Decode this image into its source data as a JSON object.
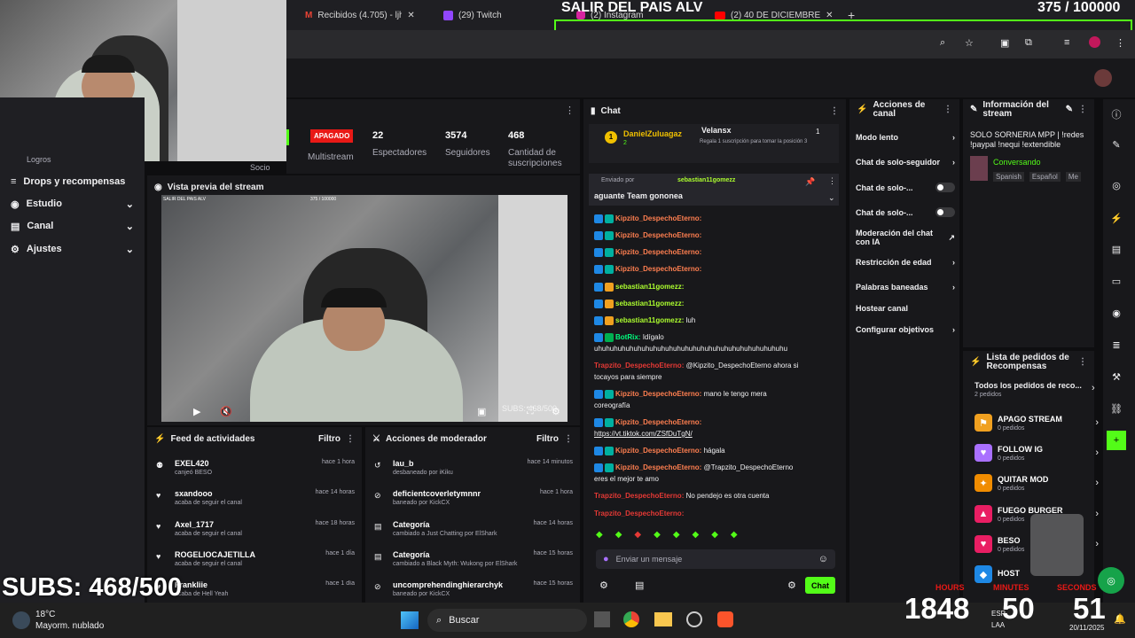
{
  "browser": {
    "tabs": [
      {
        "label": "Recibidos (4.705) - ljhe",
        "icon": "M"
      },
      {
        "label": "(29) Twitch",
        "icon": "T"
      },
      {
        "label": "(2) Instagram",
        "icon": "I"
      },
      {
        "label": "(2) 40 DE DICIEMBRE",
        "icon": "Y"
      }
    ],
    "new_tab": "+"
  },
  "overlay": {
    "title": "SALIR DEL PAIS ALV",
    "counter": "375  / 100000",
    "subs": "SUBS: 468/500",
    "timer_hours_label": "HOURS",
    "timer_minutes_label": "MINUTES",
    "timer_seconds_label": "SECONDS",
    "timer_hours": "1848",
    "timer_minutes": "50",
    "timer_seconds": "51"
  },
  "nav": {
    "partial_top": "Logros",
    "socio": "Socio",
    "items": [
      {
        "label": "Drops y recompensas",
        "icon": "≡",
        "chevron": false
      },
      {
        "label": "Estudio",
        "icon": "◉",
        "chevron": true
      },
      {
        "label": "Canal",
        "icon": "▤",
        "chevron": true
      },
      {
        "label": "Ajustes",
        "icon": "⚙",
        "chevron": true
      }
    ]
  },
  "stats": {
    "status": "APAGADO",
    "multistream": "Multistream",
    "viewers_value": "22",
    "viewers_label": "Espectadores",
    "followers_value": "3574",
    "followers_label": "Seguidores",
    "subs_value": "468",
    "subs_label": "Cantidad de suscripciones"
  },
  "preview": {
    "title": "Vista previa del stream",
    "mini_title": "SALIR DEL PAIS ALV",
    "mini_counter": "375 / 100000",
    "mini_subs": "SUBS: 468/500"
  },
  "activity_feed": {
    "title": "Feed de actividades",
    "filter": "Filtro",
    "items": [
      {
        "name": "EXEL420",
        "sub": "canjeó BESO",
        "time": "hace 1 hora",
        "icon": "gift"
      },
      {
        "name": "sxandooo",
        "sub": "acaba de seguir el canal",
        "time": "hace 14 horas",
        "icon": "heart"
      },
      {
        "name": "Axel_1717",
        "sub": "acaba de seguir el canal",
        "time": "hace 18 horas",
        "icon": "heart"
      },
      {
        "name": "ROGELIOCAJETILLA",
        "sub": "acaba de seguir el canal",
        "time": "hace 1 día",
        "icon": "heart"
      },
      {
        "name": "Frankliie",
        "sub": "acaba de Hell Yeah",
        "time": "hace 1 día",
        "icon": "heart"
      }
    ]
  },
  "mod_actions": {
    "title": "Acciones de moderador",
    "filter": "Filtro",
    "items": [
      {
        "name": "lau_b",
        "sub": "desbaneado por iKiku",
        "time": "hace 14 minutos",
        "icon": "undo"
      },
      {
        "name": "deficientcoverletymnnr",
        "sub": "baneado por KickCX",
        "time": "hace 1 hora",
        "icon": "ban"
      },
      {
        "name": "Categoría",
        "sub": "cambiado a Just Chatting por ElShark",
        "time": "hace 14 horas",
        "icon": "cat"
      },
      {
        "name": "Categoría",
        "sub": "cambiado a Black Myth: Wukong por ElShark",
        "time": "hace 15 horas",
        "icon": "cat"
      },
      {
        "name": "uncomprehendinghierarchyk",
        "sub": "baneado por KickCX",
        "time": "hace 15 horas",
        "icon": "ban"
      }
    ]
  },
  "chat": {
    "title": "Chat",
    "pinned_user": "DanielZuluagaz",
    "pinned_count": "2",
    "pinned_user2": "Velansx",
    "pinned_text2": "Regala 1 suscripción para tomar la posición 3",
    "pinned_rank": "1",
    "pinned_by": "Enviado por",
    "pinned_author": "sebastian11gomezz",
    "pinned_msg": "aguante Team gononea",
    "messages": [
      {
        "user": "Kipzito_DespechoEterno:",
        "text": "",
        "color": "#ff7f50"
      },
      {
        "user": "Kipzito_DespechoEterno:",
        "text": "",
        "color": "#ff7f50"
      },
      {
        "user": "Kipzito_DespechoEterno:",
        "text": "",
        "color": "#ff7f50"
      },
      {
        "user": "Kipzito_DespechoEterno:",
        "text": "",
        "color": "#ff7f50"
      },
      {
        "user": "sebastian11gomezz:",
        "text": "",
        "color": "#adff2f"
      },
      {
        "user": "sebastian11gomezz:",
        "text": "",
        "color": "#adff2f"
      },
      {
        "user": "sebastian11gomezz:",
        "text": "luh",
        "color": "#adff2f"
      },
      {
        "user": "BotRix:",
        "text": "Idígalo",
        "color": "#00ff7f"
      }
    ],
    "long_msg": "uhuhuhuhuhuhuhuhuhuhuhuhuhuhuhuhuhuhuhuhuhuhuhuhu",
    "msg_a_user": "Trapzito_DespechoEterno:",
    "msg_a_text": "@Kipzito_DespechoEterno ahora si",
    "msg_a_text2": "tocayos para siempre",
    "msg_b_user": "Kipzito_DespechoEterno:",
    "msg_b_text": "mano le tengo mera",
    "msg_b_text2": "coreografía",
    "msg_c_user": "Kipzito_DespechoEterno:",
    "msg_c_link": "https://vt.tiktok.com/ZSfDuTgN/",
    "msg_d_user": "Kipzito_DespechoEterno:",
    "msg_d_text": "hágala",
    "msg_e_user": "Kipzito_DespechoEterno:",
    "msg_e_text": "@Trapzito_DespechoEterno",
    "msg_e_text2": "eres el mejor te amo",
    "msg_f_user": "Trapzito_DespechoEterno:",
    "msg_f_text": "No pendejo es otra cuenta",
    "msg_g_user": "Trapzito_DespechoEterno:",
    "input_placeholder": "Enviar un mensaje",
    "send": "Chat"
  },
  "channel_actions": {
    "title": "Acciones de canal",
    "items": [
      {
        "label": "Modo lento",
        "kind": "chevron"
      },
      {
        "label": "Chat de solo-seguidor",
        "kind": "chevron"
      },
      {
        "label": "Chat de solo-...",
        "kind": "toggle"
      },
      {
        "label": "Chat de solo-...",
        "kind": "toggle"
      },
      {
        "label": "Moderación del chat con IA",
        "kind": "ext"
      },
      {
        "label": "Restricción de edad",
        "kind": "chevron"
      },
      {
        "label": "Palabras baneadas",
        "kind": "chevron"
      },
      {
        "label": "Hostear canal",
        "kind": "none"
      },
      {
        "label": "Configurar objetivos",
        "kind": "chevron"
      }
    ]
  },
  "stream_info": {
    "title": "Información del stream",
    "stream_title": "SOLO SORNERIA MPP | !redes !paypal !nequi !extendible",
    "category": "Conversando",
    "tags": [
      "Spanish",
      "Español",
      "Me"
    ]
  },
  "requests": {
    "title": "Lista de pedidos de Recompensas",
    "all_label": "Todos los pedidos de reco...",
    "all_count": "2 pedidos",
    "items": [
      {
        "name": "APAGO STREAM",
        "count": "0 pedidos",
        "color": "#f0a020",
        "icon": "⚑"
      },
      {
        "name": "FOLLOW IG",
        "count": "0 pedidos",
        "color": "#a970ff",
        "icon": "♥"
      },
      {
        "name": "QUITAR MOD",
        "count": "0 pedidos",
        "color": "#f08c00",
        "icon": "✦"
      },
      {
        "name": "FUEGO BURGER",
        "count": "0 pedidos",
        "color": "#e91e63",
        "icon": "▲"
      },
      {
        "name": "BESO",
        "count": "0 pedidos",
        "color": "#e91e63",
        "icon": "♥"
      },
      {
        "name": "HOST",
        "count": "",
        "color": "#1e88e5",
        "icon": "◆"
      }
    ]
  },
  "taskbar": {
    "weather_temp": "18°C",
    "weather_desc": "Mayorm. nublado",
    "search": "Buscar",
    "lang": "ESP",
    "lang2": "LAA",
    "date": "20/11/2025"
  }
}
